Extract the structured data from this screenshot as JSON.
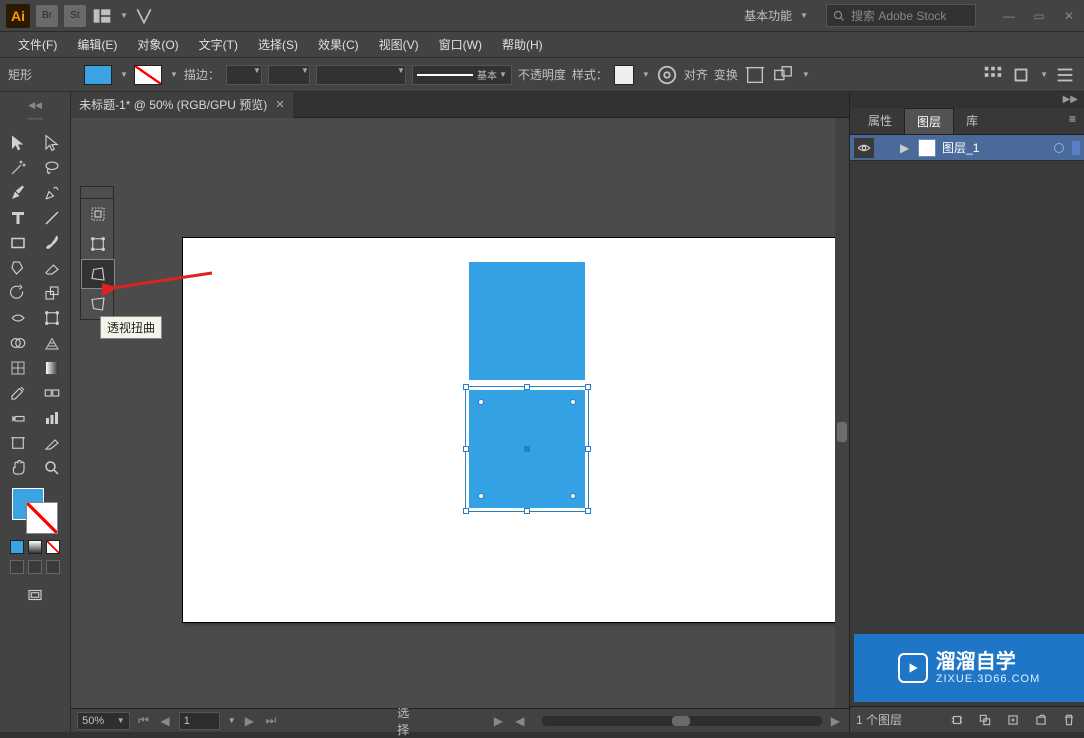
{
  "app": {
    "name": "Ai",
    "workspace": "基本功能",
    "search_placeholder": "搜索 Adobe Stock"
  },
  "menu": [
    "文件(F)",
    "编辑(E)",
    "对象(O)",
    "文字(T)",
    "选择(S)",
    "效果(C)",
    "视图(V)",
    "窗口(W)",
    "帮助(H)"
  ],
  "controlbar": {
    "shape_label": "矩形",
    "stroke_label": "描边：",
    "graphic_style_label": "基本",
    "opacity_label": "不透明度",
    "style_label": "样式：",
    "align_label": "对齐",
    "transform_label": "变换"
  },
  "document": {
    "tab_title": "未标题-1* @ 50% (RGB/GPU 预览)"
  },
  "tooltip": "透视扭曲",
  "panels": {
    "tabs": [
      "属性",
      "图层",
      "库"
    ],
    "active_tab": "图层",
    "layer": {
      "name": "图层_1"
    }
  },
  "status": {
    "zoom": "50%",
    "page": "1",
    "mode": "选择"
  },
  "layers_footer": {
    "count": "1 个图层"
  },
  "watermark": {
    "text": "溜溜自学",
    "url": "ZIXUE.3D66.COM"
  }
}
